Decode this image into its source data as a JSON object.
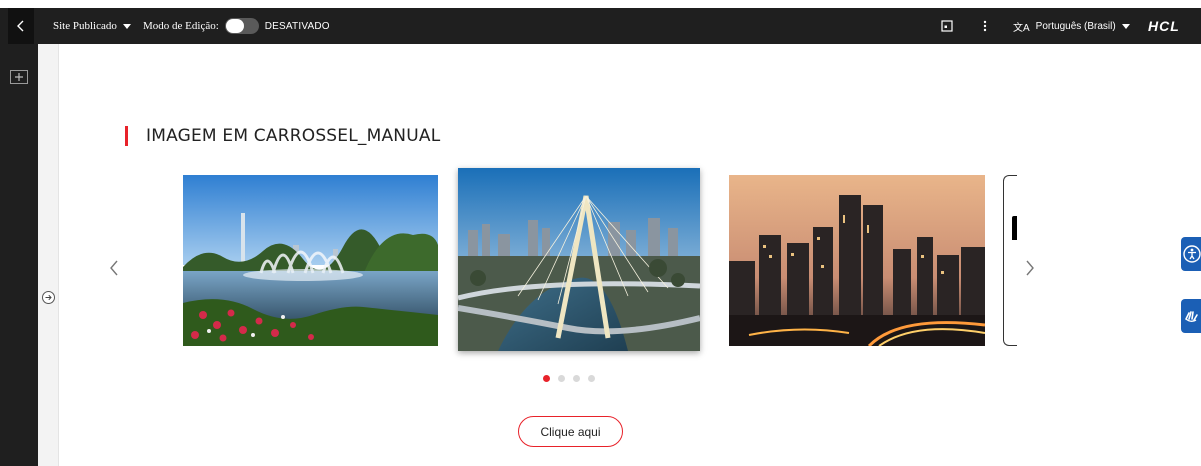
{
  "toolbar": {
    "site_select": "Site Publicado",
    "edit_mode_label": "Modo de Edição:",
    "edit_mode_state": "DESATIVADO",
    "edit_mode_on": false,
    "language": "Português (Brasil)",
    "language_glyph": "文A",
    "brand": "HCL"
  },
  "section": {
    "title": "IMAGEM EM CARROSSEL_MANUAL"
  },
  "carousel": {
    "slide_count": 4,
    "active_dot": 0
  },
  "cta": {
    "label": "Clique aqui"
  },
  "colors": {
    "accent": "#e8222a",
    "toolbar_bg": "#1f1f1f",
    "a11y_blue": "#1b5fb5"
  },
  "icons": {
    "back": "chevron-left-icon",
    "panel": "panel-icon",
    "more": "kebab-icon",
    "translate": "translate-icon",
    "add_component": "add-component-icon",
    "expand": "expand-arrow-icon",
    "carousel_prev": "chevron-left-icon",
    "carousel_next": "chevron-right-icon",
    "accessibility": "accessibility-icon",
    "sign_language": "sign-language-icon"
  }
}
